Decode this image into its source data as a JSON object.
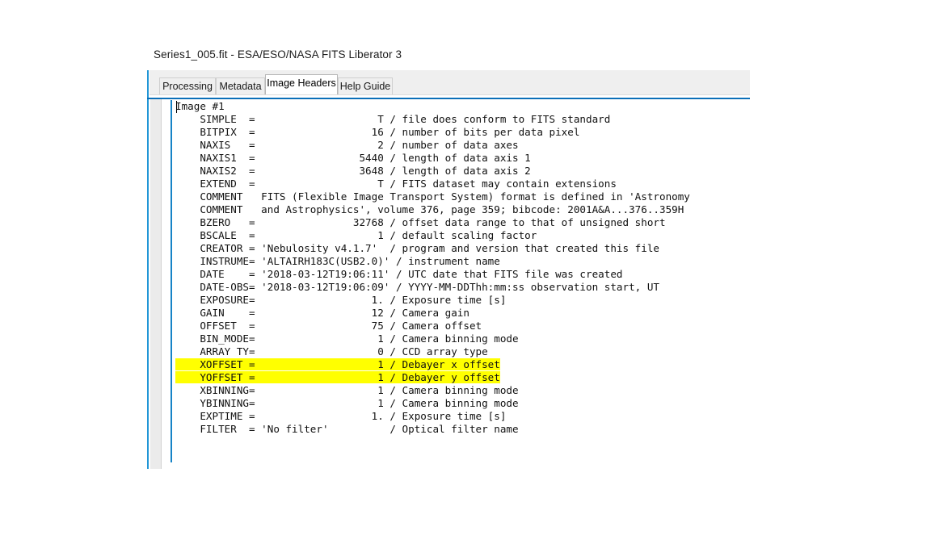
{
  "window": {
    "title": "Series1_005.fit - ESA/ESO/NASA FITS Liberator 3",
    "accent_color": "#0b6fb8",
    "highlight_color": "#ffff00"
  },
  "tabs": [
    {
      "label": "Processing",
      "active": false
    },
    {
      "label": "Metadata",
      "active": false
    },
    {
      "label": "Image Headers",
      "active": true
    },
    {
      "label": "Help Guide",
      "active": false
    }
  ],
  "header_panel": {
    "image_label": "Image #1",
    "lines": [
      {
        "text": "Image #1",
        "highlight": false
      },
      {
        "text": "    SIMPLE  =                    T / file does conform to FITS standard",
        "highlight": false
      },
      {
        "text": "    BITPIX  =                   16 / number of bits per data pixel",
        "highlight": false
      },
      {
        "text": "    NAXIS   =                    2 / number of data axes",
        "highlight": false
      },
      {
        "text": "    NAXIS1  =                 5440 / length of data axis 1",
        "highlight": false
      },
      {
        "text": "    NAXIS2  =                 3648 / length of data axis 2",
        "highlight": false
      },
      {
        "text": "    EXTEND  =                    T / FITS dataset may contain extensions",
        "highlight": false
      },
      {
        "text": "    COMMENT   FITS (Flexible Image Transport System) format is defined in 'Astronomy",
        "highlight": false
      },
      {
        "text": "    COMMENT   and Astrophysics', volume 376, page 359; bibcode: 2001A&A...376..359H",
        "highlight": false
      },
      {
        "text": "    BZERO   =                32768 / offset data range to that of unsigned short",
        "highlight": false
      },
      {
        "text": "    BSCALE  =                    1 / default scaling factor",
        "highlight": false
      },
      {
        "text": "    CREATOR = 'Nebulosity v4.1.7'  / program and version that created this file",
        "highlight": false
      },
      {
        "text": "    INSTRUME= 'ALTAIRH183C(USB2.0)' / instrument name",
        "highlight": false
      },
      {
        "text": "    DATE    = '2018-03-12T19:06:11' / UTC date that FITS file was created",
        "highlight": false
      },
      {
        "text": "    DATE-OBS= '2018-03-12T19:06:09' / YYYY-MM-DDThh:mm:ss observation start, UT",
        "highlight": false
      },
      {
        "text": "    EXPOSURE=                   1. / Exposure time [s]",
        "highlight": false
      },
      {
        "text": "    GAIN    =                   12 / Camera gain",
        "highlight": false
      },
      {
        "text": "    OFFSET  =                   75 / Camera offset",
        "highlight": false
      },
      {
        "text": "    BIN_MODE=                    1 / Camera binning mode",
        "highlight": false
      },
      {
        "text": "    ARRAY TY=                    0 / CCD array type",
        "highlight": false
      },
      {
        "text": "    XOFFSET =                    1 / Debayer x offset",
        "highlight": true
      },
      {
        "text": "    YOFFSET =                    1 / Debayer y offset",
        "highlight": true
      },
      {
        "text": "    XBINNING=                    1 / Camera binning mode",
        "highlight": false
      },
      {
        "text": "    YBINNING=                    1 / Camera binning mode",
        "highlight": false
      },
      {
        "text": "    EXPTIME =                   1. / Exposure time [s]",
        "highlight": false
      },
      {
        "text": "    FILTER  = 'No filter'          / Optical filter name",
        "highlight": false
      }
    ]
  }
}
